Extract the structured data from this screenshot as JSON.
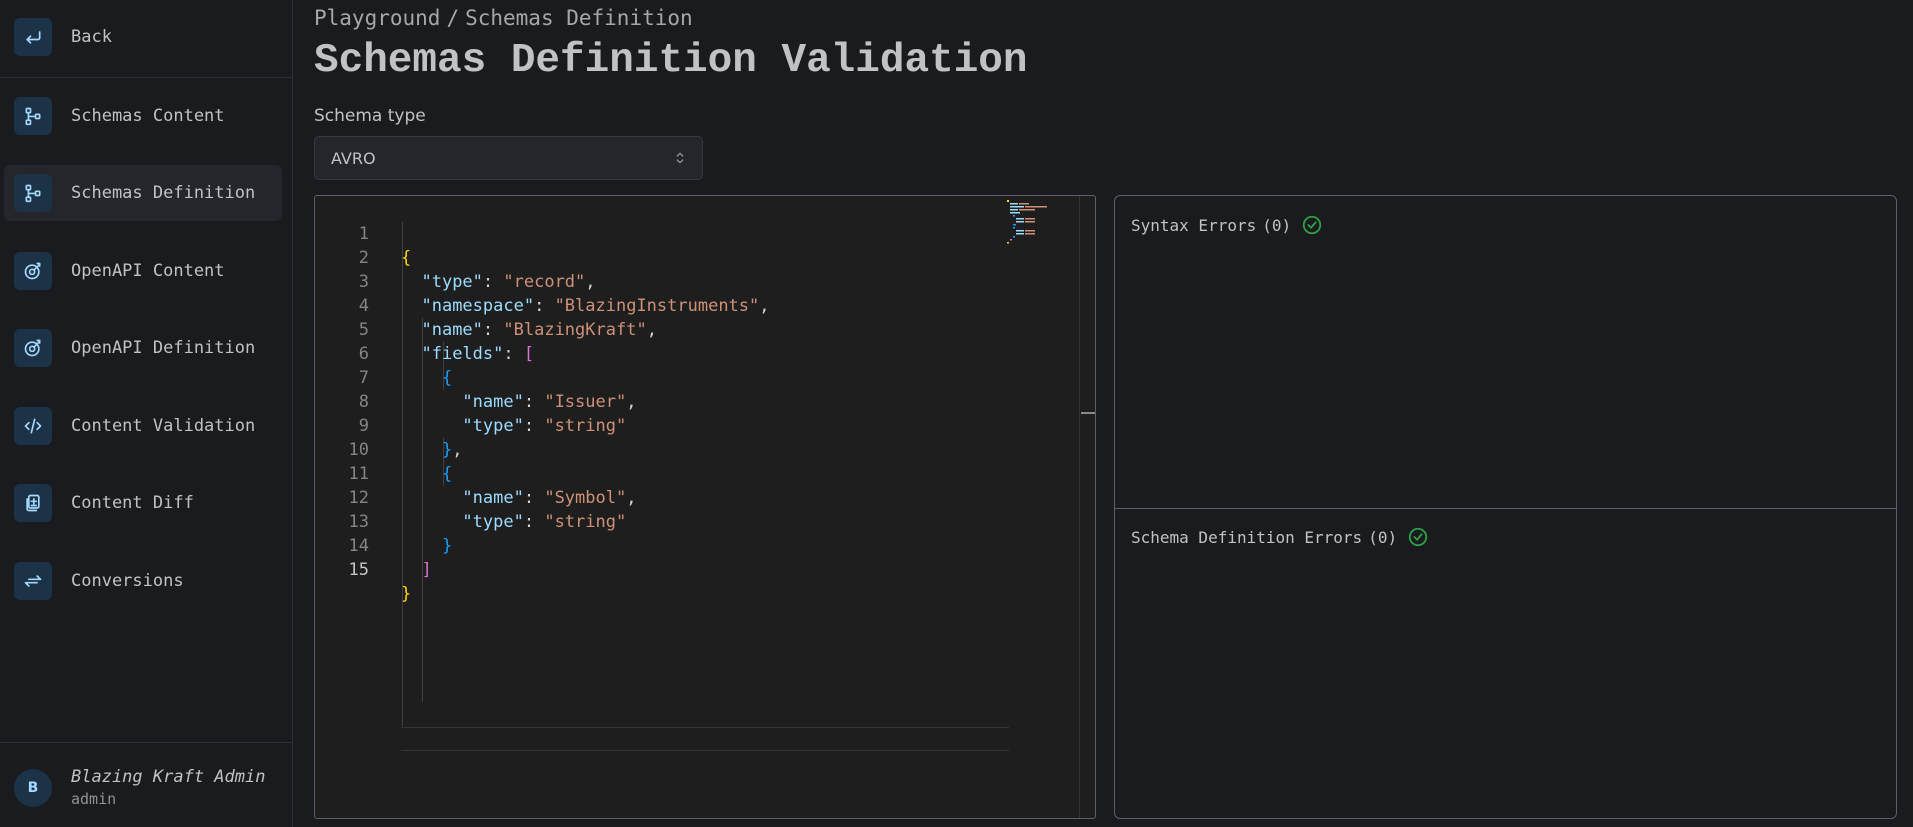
{
  "sidebar": {
    "back_label": "Back",
    "items": [
      {
        "label": "Schemas Content",
        "icon": "schema-icon"
      },
      {
        "label": "Schemas Definition",
        "icon": "schema-icon",
        "active": true
      },
      {
        "label": "OpenAPI Content",
        "icon": "openapi-icon"
      },
      {
        "label": "OpenAPI Definition",
        "icon": "openapi-icon"
      },
      {
        "label": "Content Validation",
        "icon": "code-icon"
      },
      {
        "label": "Content Diff",
        "icon": "file-diff-icon"
      },
      {
        "label": "Conversions",
        "icon": "arrows-exchange-icon"
      }
    ],
    "user": {
      "initial": "B",
      "name": "Blazing Kraft Admin",
      "role": "admin"
    }
  },
  "header": {
    "breadcrumb": [
      "Playground",
      "Schemas Definition"
    ],
    "breadcrumb_sep": "/",
    "title": "Schemas Definition Validation"
  },
  "schema_type": {
    "label": "Schema type",
    "value": "AVRO"
  },
  "editor": {
    "line_numbers": [
      "1",
      "2",
      "3",
      "4",
      "5",
      "6",
      "7",
      "8",
      "9",
      "10",
      "11",
      "12",
      "13",
      "14",
      "15"
    ],
    "lines": [
      "{",
      "  \"type\": \"record\",",
      "  \"namespace\": \"BlazingInstruments\",",
      "  \"name\": \"BlazingKraft\",",
      "  \"fields\": [",
      "    {",
      "      \"name\": \"Issuer\",",
      "      \"type\": \"string\"",
      "    },",
      "    {",
      "      \"name\": \"Symbol\",",
      "      \"type\": \"string\"",
      "    }",
      "  ]",
      "}"
    ],
    "current_line": 15
  },
  "errors": {
    "syntax": {
      "label": "Syntax Errors",
      "count": "(0)"
    },
    "schema_definition": {
      "label": "Schema Definition Errors",
      "count": "(0)"
    }
  },
  "colors": {
    "accent": "#a5d8ff",
    "success": "#2f9e44",
    "background": "#1a1b1e"
  }
}
